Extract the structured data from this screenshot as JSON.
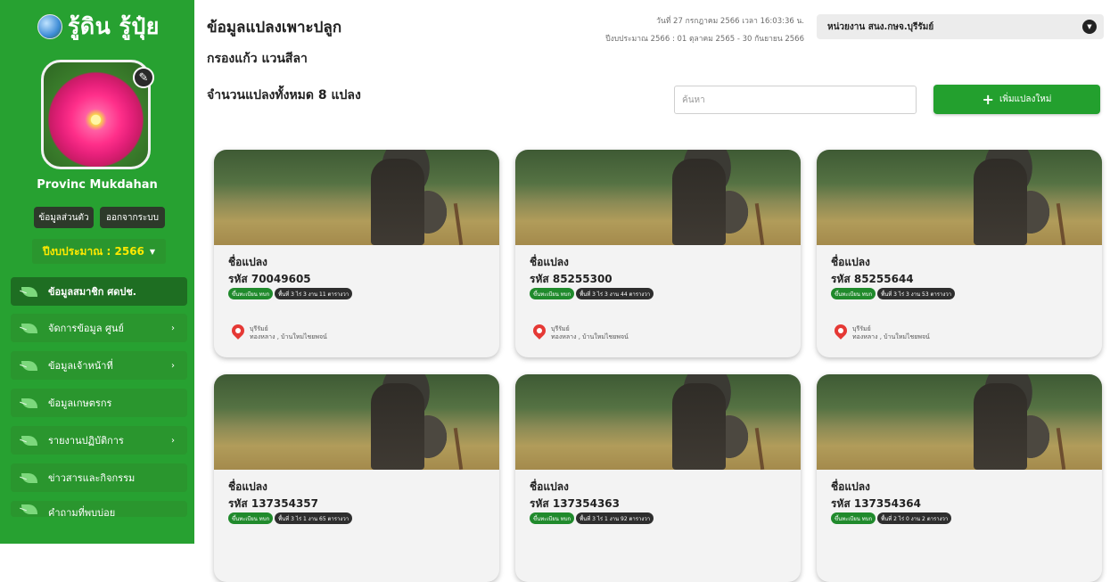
{
  "sidebar": {
    "logo_text": "รู้ดิน รู้ปุ๋ย",
    "user_name": "Provinc Mukdahan",
    "profile_button": "ข้อมูลส่วนตัว",
    "logout_button": "ออกจากระบบ",
    "fiscal_year": "ปีงบประมาณ : 2566",
    "nav": [
      {
        "label": "ข้อมูลสมาชิก ศดปช.",
        "icon": "leaf-icon",
        "active": true,
        "has_submenu": false
      },
      {
        "label": "จัดการข้อมูล ศูนย์",
        "icon": "leaf-icon",
        "active": false,
        "has_submenu": true
      },
      {
        "label": "ข้อมูลเจ้าหน้าที่",
        "icon": "leaf-icon",
        "active": false,
        "has_submenu": true
      },
      {
        "label": "ข้อมูลเกษตรกร",
        "icon": "leaf-icon",
        "active": false,
        "has_submenu": false
      },
      {
        "label": "รายงานปฏิบัติการ",
        "icon": "leaf-icon",
        "active": false,
        "has_submenu": true
      },
      {
        "label": "ข่าวสารและกิจกรรม",
        "icon": "leaf-icon",
        "active": false,
        "has_submenu": false
      },
      {
        "label": "คำถามที่พบบ่อย",
        "icon": "leaf-icon",
        "active": false,
        "has_submenu": false
      }
    ]
  },
  "header": {
    "title": "ข้อมูลแปลงเพาะปลูก",
    "subtitle": "กรองแก้ว แวนสีลา",
    "plot_count": "จำนวนแปลงทั้งหมด 8 แปลง",
    "datetime_line1": "วันที่ 27 กรกฎาคม 2566 เวลา 16:03:36 น.",
    "datetime_line2": "ปีงบประมาณ 2566 : 01 ตุลาคม 2565 - 30 กันยายน 2566",
    "agency": "หน่วยงาน สนง.กษจ.บุรีรัมย์",
    "search_placeholder": "ค้นหา",
    "add_button": "เพิ่มแปลงใหม่"
  },
  "cards": [
    {
      "name_label": "ชื่อแปลง",
      "code": "รหัส 70049605",
      "badge_status": "ขึ้นทะเบียน ทบก",
      "badge_area": "พื้นที่ 3 ไร่ 3 งาน 11 ตารางวา",
      "province": "บุรีรัมย์",
      "location": "ทองหลาง , บ้านใหม่ไชยพจน์"
    },
    {
      "name_label": "ชื่อแปลง",
      "code": "รหัส 85255300",
      "badge_status": "ขึ้นทะเบียน ทบก",
      "badge_area": "พื้นที่ 3 ไร่ 3 งาน 44 ตารางวา",
      "province": "บุรีรัมย์",
      "location": "ทองหลาง , บ้านใหม่ไชยพจน์"
    },
    {
      "name_label": "ชื่อแปลง",
      "code": "รหัส 85255644",
      "badge_status": "ขึ้นทะเบียน ทบก",
      "badge_area": "พื้นที่ 3 ไร่ 3 งาน 53 ตารางวา",
      "province": "บุรีรัมย์",
      "location": "ทองหลาง , บ้านใหม่ไชยพจน์"
    },
    {
      "name_label": "ชื่อแปลง",
      "code": "รหัส 137354357",
      "badge_status": "ขึ้นทะเบียน ทบก",
      "badge_area": "พื้นที่ 3 ไร่ 1 งาน 65 ตารางวา",
      "province": "",
      "location": ""
    },
    {
      "name_label": "ชื่อแปลง",
      "code": "รหัส 137354363",
      "badge_status": "ขึ้นทะเบียน ทบก",
      "badge_area": "พื้นที่ 3 ไร่ 1 งาน 92 ตารางวา",
      "province": "",
      "location": ""
    },
    {
      "name_label": "ชื่อแปลง",
      "code": "รหัส 137354364",
      "badge_status": "ขึ้นทะเบียน ทบก",
      "badge_area": "พื้นที่ 2 ไร่ 0 งาน 2 ตารางวา",
      "province": "",
      "location": ""
    }
  ],
  "colors": {
    "sidebar_bg": "#27a131",
    "accent_yellow": "#ffe900",
    "primary_button": "#23a02e",
    "pin_red": "#e53935"
  }
}
